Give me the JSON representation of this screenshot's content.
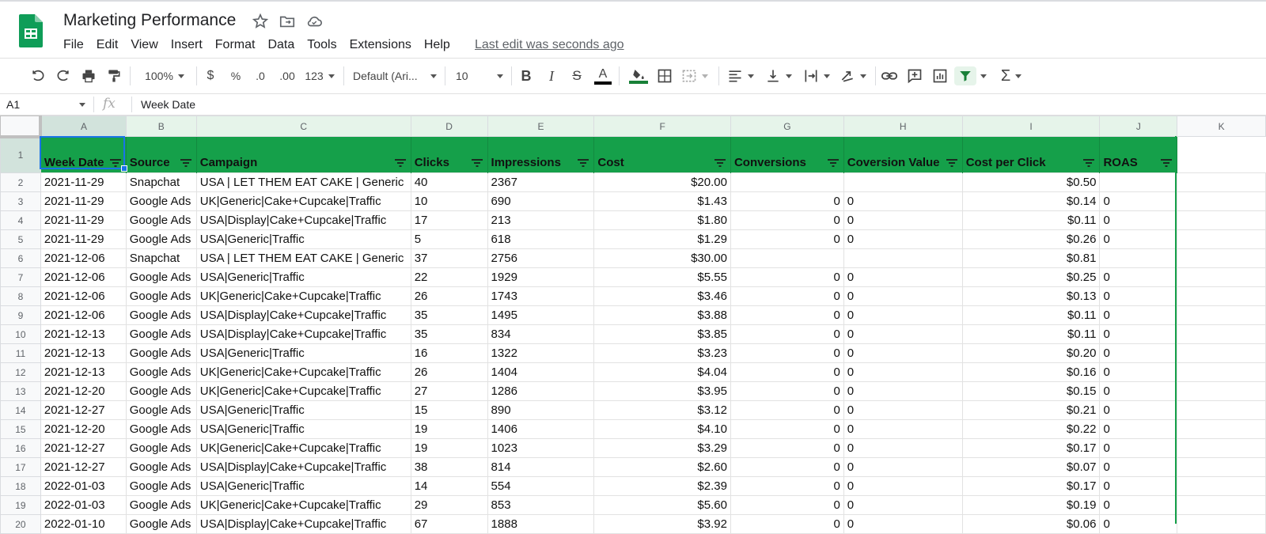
{
  "app": {
    "doc_title": "Marketing Performance",
    "menus": [
      "File",
      "Edit",
      "View",
      "Insert",
      "Format",
      "Data",
      "Tools",
      "Extensions",
      "Help"
    ],
    "last_edit": "Last edit was seconds ago"
  },
  "toolbar": {
    "zoom": "100%",
    "currency": "$",
    "percent": "%",
    "decrease_decimal": ".0",
    "increase_decimal": ".00",
    "more_formats": "123",
    "font": "Default (Ari...",
    "font_size": "10",
    "accent_green": "#188038"
  },
  "formula_bar": {
    "name_box": "A1",
    "fx": "fx",
    "value": "Week Date"
  },
  "grid": {
    "column_letters": [
      "A",
      "B",
      "C",
      "D",
      "E",
      "F",
      "G",
      "H",
      "I",
      "J",
      "K"
    ],
    "header_row_number": "1",
    "headers": [
      "Week Date",
      "Source",
      "Campaign",
      "Clicks",
      "Impressions",
      "Cost",
      "Conversions",
      "Coversion Value",
      "Cost per Click",
      "ROAS"
    ],
    "header_color": "#15a04a",
    "rows": [
      {
        "n": "2",
        "cells": [
          "2021-11-29",
          "Snapchat",
          "USA | LET THEM EAT CAKE | Generic",
          "40",
          "2367",
          "$20.00",
          "",
          "",
          "$0.50",
          ""
        ]
      },
      {
        "n": "3",
        "cells": [
          "2021-11-29",
          "Google Ads",
          "UK|Generic|Cake+Cupcake|Traffic",
          "10",
          "690",
          "$1.43",
          "0",
          "0",
          "$0.14",
          "0"
        ]
      },
      {
        "n": "4",
        "cells": [
          "2021-11-29",
          "Google Ads",
          "USA|Display|Cake+Cupcake|Traffic",
          "17",
          "213",
          "$1.80",
          "0",
          "0",
          "$0.11",
          "0"
        ]
      },
      {
        "n": "5",
        "cells": [
          "2021-11-29",
          "Google Ads",
          "USA|Generic|Traffic",
          "5",
          "618",
          "$1.29",
          "0",
          "0",
          "$0.26",
          "0"
        ]
      },
      {
        "n": "6",
        "cells": [
          "2021-12-06",
          "Snapchat",
          "USA | LET THEM EAT CAKE | Generic",
          "37",
          "2756",
          "$30.00",
          "",
          "",
          "$0.81",
          ""
        ]
      },
      {
        "n": "7",
        "cells": [
          "2021-12-06",
          "Google Ads",
          "USA|Generic|Traffic",
          "22",
          "1929",
          "$5.55",
          "0",
          "0",
          "$0.25",
          "0"
        ]
      },
      {
        "n": "8",
        "cells": [
          "2021-12-06",
          "Google Ads",
          "UK|Generic|Cake+Cupcake|Traffic",
          "26",
          "1743",
          "$3.46",
          "0",
          "0",
          "$0.13",
          "0"
        ]
      },
      {
        "n": "9",
        "cells": [
          "2021-12-06",
          "Google Ads",
          "USA|Display|Cake+Cupcake|Traffic",
          "35",
          "1495",
          "$3.88",
          "0",
          "0",
          "$0.11",
          "0"
        ]
      },
      {
        "n": "10",
        "cells": [
          "2021-12-13",
          "Google Ads",
          "USA|Display|Cake+Cupcake|Traffic",
          "35",
          "834",
          "$3.85",
          "0",
          "0",
          "$0.11",
          "0"
        ]
      },
      {
        "n": "11",
        "cells": [
          "2021-12-13",
          "Google Ads",
          "USA|Generic|Traffic",
          "16",
          "1322",
          "$3.23",
          "0",
          "0",
          "$0.20",
          "0"
        ]
      },
      {
        "n": "12",
        "cells": [
          "2021-12-13",
          "Google Ads",
          "UK|Generic|Cake+Cupcake|Traffic",
          "26",
          "1404",
          "$4.04",
          "0",
          "0",
          "$0.16",
          "0"
        ]
      },
      {
        "n": "13",
        "cells": [
          "2021-12-20",
          "Google Ads",
          "UK|Generic|Cake+Cupcake|Traffic",
          "27",
          "1286",
          "$3.95",
          "0",
          "0",
          "$0.15",
          "0"
        ]
      },
      {
        "n": "14",
        "cells": [
          "2021-12-27",
          "Google Ads",
          "USA|Generic|Traffic",
          "15",
          "890",
          "$3.12",
          "0",
          "0",
          "$0.21",
          "0"
        ]
      },
      {
        "n": "15",
        "cells": [
          "2021-12-20",
          "Google Ads",
          "USA|Generic|Traffic",
          "19",
          "1406",
          "$4.10",
          "0",
          "0",
          "$0.22",
          "0"
        ]
      },
      {
        "n": "16",
        "cells": [
          "2021-12-27",
          "Google Ads",
          "UK|Generic|Cake+Cupcake|Traffic",
          "19",
          "1023",
          "$3.29",
          "0",
          "0",
          "$0.17",
          "0"
        ]
      },
      {
        "n": "17",
        "cells": [
          "2021-12-27",
          "Google Ads",
          "USA|Display|Cake+Cupcake|Traffic",
          "38",
          "814",
          "$2.60",
          "0",
          "0",
          "$0.07",
          "0"
        ]
      },
      {
        "n": "18",
        "cells": [
          "2022-01-03",
          "Google Ads",
          "USA|Generic|Traffic",
          "14",
          "554",
          "$2.39",
          "0",
          "0",
          "$0.17",
          "0"
        ]
      },
      {
        "n": "19",
        "cells": [
          "2022-01-03",
          "Google Ads",
          "UK|Generic|Cake+Cupcake|Traffic",
          "29",
          "853",
          "$5.60",
          "0",
          "0",
          "$0.19",
          "0"
        ]
      },
      {
        "n": "20",
        "cells": [
          "2022-01-10",
          "Google Ads",
          "USA|Display|Cake+Cupcake|Traffic",
          "67",
          "1888",
          "$3.92",
          "0",
          "0",
          "$0.06",
          "0"
        ]
      }
    ]
  }
}
